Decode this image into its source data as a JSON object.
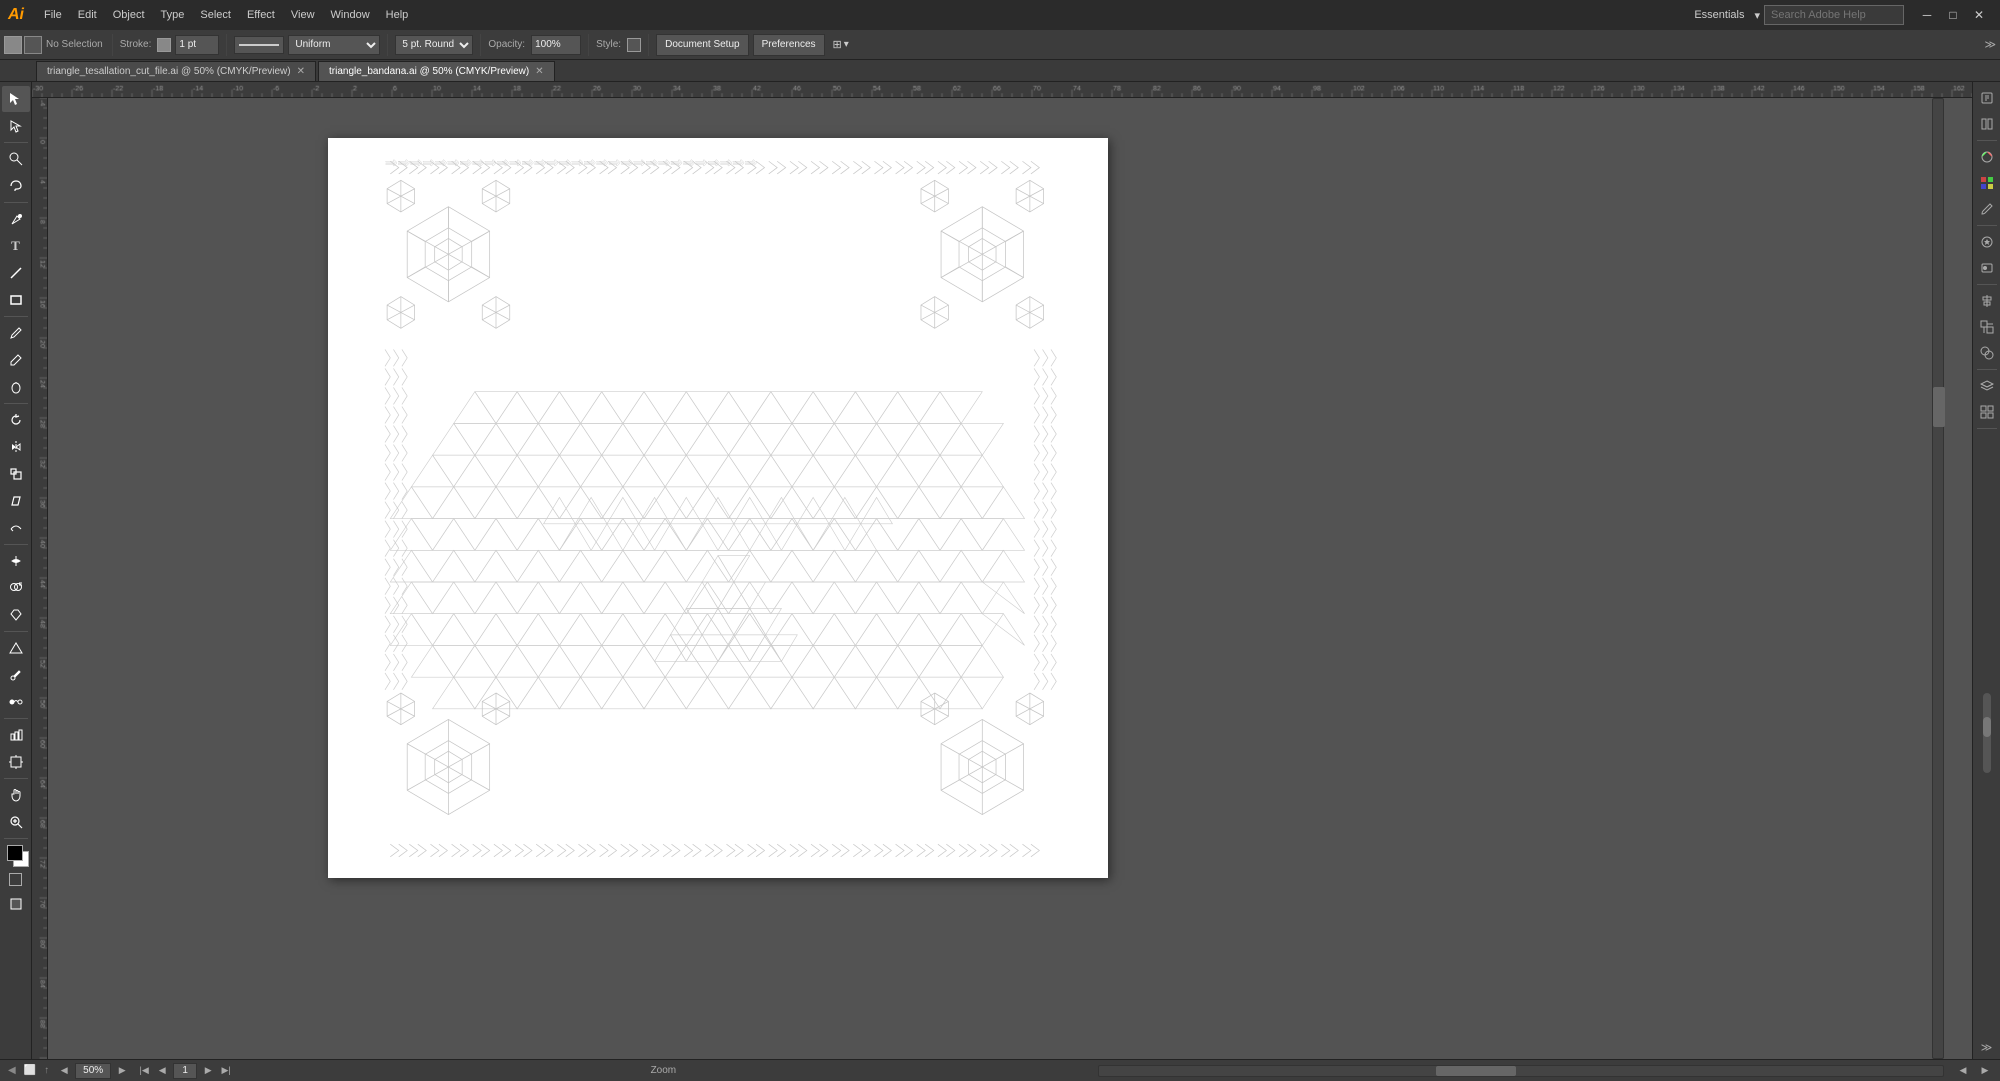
{
  "app": {
    "logo": "Ai",
    "workspace": "Essentials",
    "search_placeholder": "Search Adobe Help"
  },
  "menu": {
    "items": [
      "File",
      "Edit",
      "Object",
      "Type",
      "Select",
      "Effect",
      "View",
      "Window",
      "Help"
    ]
  },
  "toolbar": {
    "selection_label": "No Selection",
    "stroke_label": "Stroke:",
    "stroke_value": "1 pt",
    "profile_label": "Uniform",
    "brush_label": "5 pt. Round",
    "opacity_label": "Opacity:",
    "opacity_value": "100%",
    "style_label": "Style:",
    "document_setup": "Document Setup",
    "preferences": "Preferences"
  },
  "tabs": [
    {
      "id": "tab1",
      "label": "triangle_tesallation_cut_file.ai @ 50% (CMYK/Preview)",
      "active": false
    },
    {
      "id": "tab2",
      "label": "triangle_bandana.ai @ 50% (CMYK/Preview)",
      "active": true
    }
  ],
  "tools": {
    "left": [
      {
        "name": "selection-tool",
        "icon": "↖",
        "active": true
      },
      {
        "name": "direct-select-tool",
        "icon": "↗",
        "active": false
      },
      {
        "name": "magic-wand-tool",
        "icon": "✦",
        "active": false
      },
      {
        "name": "lasso-tool",
        "icon": "⌀",
        "active": false
      },
      {
        "name": "pen-tool",
        "icon": "✒",
        "active": false
      },
      {
        "name": "type-tool",
        "icon": "T",
        "active": false
      },
      {
        "name": "line-tool",
        "icon": "╲",
        "active": false
      },
      {
        "name": "rectangle-tool",
        "icon": "▭",
        "active": false
      },
      {
        "name": "paintbrush-tool",
        "icon": "✏",
        "active": false
      },
      {
        "name": "pencil-tool",
        "icon": "✎",
        "active": false
      },
      {
        "name": "blob-brush-tool",
        "icon": "⬤",
        "active": false
      },
      {
        "name": "rotate-tool",
        "icon": "↻",
        "active": false
      },
      {
        "name": "reflect-tool",
        "icon": "⇔",
        "active": false
      },
      {
        "name": "scale-tool",
        "icon": "⤢",
        "active": false
      },
      {
        "name": "shear-tool",
        "icon": "▱",
        "active": false
      },
      {
        "name": "puppet-warp-tool",
        "icon": "⊛",
        "active": false
      },
      {
        "name": "width-tool",
        "icon": "⟺",
        "active": false
      },
      {
        "name": "shape-builder-tool",
        "icon": "⊕",
        "active": false
      },
      {
        "name": "live-paint-tool",
        "icon": "🪣",
        "active": false
      },
      {
        "name": "perspective-grid-tool",
        "icon": "⏣",
        "active": false
      },
      {
        "name": "eyedropper-tool",
        "icon": "⌀",
        "active": false
      },
      {
        "name": "measure-tool",
        "icon": "📏",
        "active": false
      },
      {
        "name": "blend-tool",
        "icon": "⊗",
        "active": false
      },
      {
        "name": "symbol-sprayer-tool",
        "icon": "⊙",
        "active": false
      },
      {
        "name": "graph-tool",
        "icon": "▦",
        "active": false
      },
      {
        "name": "artboard-tool",
        "icon": "⬜",
        "active": false
      },
      {
        "name": "slice-tool",
        "icon": "✂",
        "active": false
      },
      {
        "name": "hand-tool",
        "icon": "✋",
        "active": false
      },
      {
        "name": "zoom-tool",
        "icon": "🔍",
        "active": false
      }
    ]
  },
  "status_bar": {
    "zoom_value": "50%",
    "zoom_label": "Zoom",
    "page_current": "1",
    "artboard_count": "1",
    "status_text": "Zoom"
  },
  "right_panel": {
    "buttons": [
      "⬛",
      "⬛",
      "⬛",
      "⬛",
      "⬛",
      "⬛",
      "⬛",
      "⬛",
      "⬛",
      "⬛",
      "⬛",
      "⬛",
      "⬛"
    ]
  },
  "colors": {
    "bg": "#535353",
    "toolbar_bg": "#3c3c3c",
    "title_bg": "#2b2b2b",
    "artboard_bg": "#ffffff",
    "accent": "#FF9A00",
    "tab_active": "#535353",
    "tab_inactive": "#4a4a4a"
  }
}
